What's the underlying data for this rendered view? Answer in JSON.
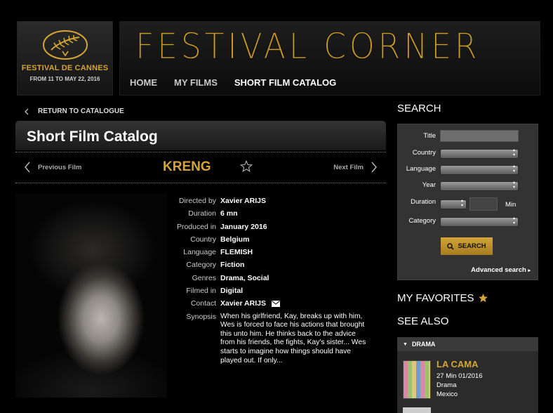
{
  "header": {
    "logo_name": "FESTIVAL DE CANNES",
    "logo_dates": "FROM 11 TO MAY 22, 2016",
    "banner_title": "FESTIVAL CORNER",
    "nav": [
      "HOME",
      "MY FILMS",
      "SHORT FILM CATALOG"
    ]
  },
  "main": {
    "back_label": "RETURN TO CATALOGUE",
    "catalog_title": "Short Film Catalog",
    "prev_label": "Previous Film",
    "next_label": "Next Film",
    "film_title": "KRENG",
    "details": [
      {
        "label": "Directed by",
        "value": "Xavier ARIJS"
      },
      {
        "label": "Duration",
        "value": "6 mn"
      },
      {
        "label": "Produced in",
        "value": "January 2016"
      },
      {
        "label": "Country",
        "value": "Belgium"
      },
      {
        "label": "Language",
        "value": "FLEMISH"
      },
      {
        "label": "Category",
        "value": "Fiction"
      },
      {
        "label": "Genres",
        "value": "Drama, Social"
      },
      {
        "label": "Filmed in",
        "value": "Digital"
      },
      {
        "label": "Contact",
        "value": "Xavier ARIJS"
      }
    ],
    "synopsis_label": "Synopsis",
    "synopsis": "When his girlfriend, Kay, breaks up with him, Wes is forced to face his actions that brought this unto him. He thinks back to the advice from his friends, the fights, Kay's sister... Wes starts to imagine how things should have played out. If only..."
  },
  "sidebar": {
    "search_heading": "SEARCH",
    "fields": {
      "title": "Title",
      "country": "Country",
      "language": "Language",
      "year": "Year",
      "duration": "Duration",
      "min": "Min",
      "category": "Category"
    },
    "search_button": "SEARCH",
    "advanced": "Advanced search",
    "favorites_heading": "MY FAVORITES",
    "see_also_heading": "SEE ALSO",
    "see_also_group": "DRAMA",
    "see_also_item": {
      "title": "LA CAMA",
      "meta1": "27 Min 01/2016",
      "meta2": "Drama",
      "meta3": "Mexico"
    }
  },
  "colors": {
    "gold": "#d4a535",
    "background": "#000000",
    "panel": "#333333"
  }
}
